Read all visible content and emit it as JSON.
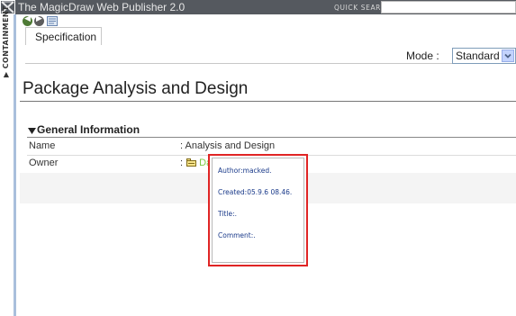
{
  "header": {
    "app_title": "The MagicDraw Web Publisher 2.0",
    "quick_search_label": "QUICK SEARCH:",
    "quick_search_value": ""
  },
  "rail": {
    "label": "CONTAINMENT",
    "logo_icon": "magicdraw-logo-icon",
    "collapse_icon": "triangle-right-icon"
  },
  "toolbar": {
    "back_icon": "back-arrow-icon",
    "forward_icon": "forward-arrow-icon",
    "doc_icon": "document-icon"
  },
  "tabs": {
    "specification": "Specification"
  },
  "mode": {
    "label": "Mode :",
    "selected": "Standard"
  },
  "page": {
    "title": "Package Analysis and Design"
  },
  "general_info": {
    "heading": "General Information",
    "rows": [
      {
        "key": "Name",
        "value": ": Analysis and Design"
      },
      {
        "key": "Owner",
        "value_prefix": ":",
        "value_link": "Data",
        "value_icon": "package-icon"
      }
    ]
  },
  "tooltip": {
    "author": "Author:macked.",
    "created": "Created:05.9.6 08.46.",
    "title": "Title:.",
    "comment": "Comment:."
  },
  "colors": {
    "header_bg": "#55595f",
    "rail_bar": "#a9bfdc",
    "link_green": "#7ac943",
    "tooltip_border": "#e02424",
    "tooltip_text": "#1a3a8a"
  }
}
